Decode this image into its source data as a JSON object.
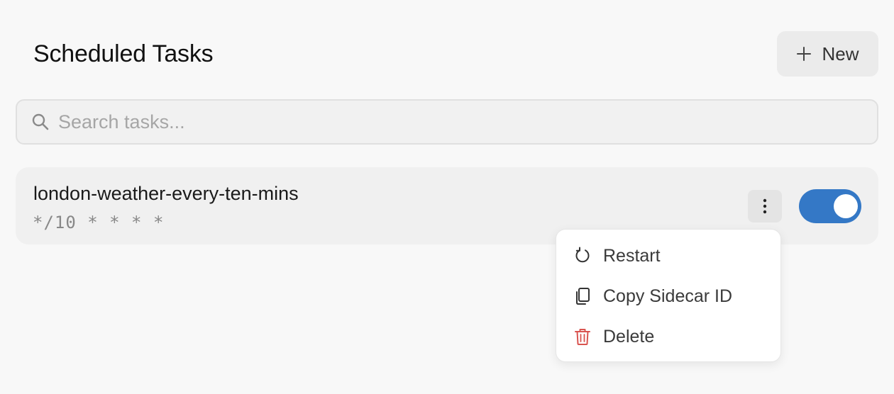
{
  "header": {
    "title": "Scheduled Tasks",
    "new_button_label": "New",
    "new_button_icon": "plus-icon"
  },
  "search": {
    "placeholder": "Search tasks...",
    "value": "",
    "icon": "search-icon"
  },
  "tasks": [
    {
      "name": "london-weather-every-ten-mins",
      "schedule": "*/10 * * * *",
      "enabled": true,
      "more_icon": "more-vertical-icon"
    }
  ],
  "menu": {
    "items": [
      {
        "label": "Restart",
        "icon": "restart-icon"
      },
      {
        "label": "Copy Sidecar ID",
        "icon": "copy-icon"
      },
      {
        "label": "Delete",
        "icon": "trash-icon",
        "color": "#d9534f"
      }
    ]
  },
  "colors": {
    "accent": "#3478c6",
    "danger": "#d9534f"
  }
}
